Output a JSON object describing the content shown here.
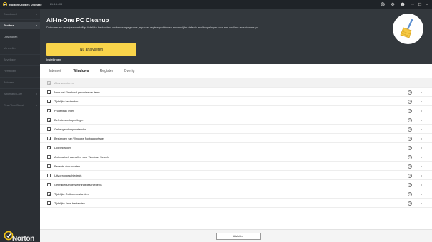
{
  "titlebar": {
    "app_title": "Norton Utilities Ultimate",
    "version": "21.4.5.408",
    "icons": [
      "globe-icon",
      "gear-icon",
      "help-icon",
      "minimize-icon",
      "maximize-icon",
      "close-icon"
    ]
  },
  "sidebar": {
    "items": [
      {
        "label": "Dashboard",
        "state": "dim",
        "has_chevron": true
      },
      {
        "label": "Toolbox",
        "state": "active",
        "has_chevron": true
      },
      {
        "label": "Opschonen",
        "state": "bright",
        "has_chevron": false
      },
      {
        "label": "Versnellen",
        "state": "dim",
        "has_chevron": false
      },
      {
        "label": "Beveiligen",
        "state": "dim",
        "has_chevron": false
      },
      {
        "label": "Herstellen",
        "state": "dim",
        "has_chevron": false
      },
      {
        "label": "Beheren",
        "state": "dim",
        "has_chevron": false
      },
      {
        "label": "Automatic Care",
        "state": "dim",
        "has_chevron": true
      },
      {
        "label": "Real-Time Boost",
        "state": "dim",
        "has_chevron": true
      }
    ],
    "brand": "Norton"
  },
  "header": {
    "title": "All-in-One PC Cleanup",
    "description": "Detecteer en verwijder overtollige tijdelijke bestanden, uw browsergegevens, repareer registerproblemen en verwijder defecte snelkoppelingen voor een snellere en schonere pc.",
    "analyze_button": "Nu analyseren",
    "settings_link": "Instellingen"
  },
  "tabs": [
    {
      "label": "Internet",
      "active": false
    },
    {
      "label": "Windows",
      "active": true
    },
    {
      "label": "Register",
      "active": false
    },
    {
      "label": "Overig",
      "active": false
    }
  ],
  "list": {
    "select_all": {
      "label": "Alles selecteren",
      "checked": true
    },
    "items": [
      {
        "label": "Naar het Klembord gekopieerde items",
        "checked": true
      },
      {
        "label": "Tijdelijke bestanden",
        "checked": true
      },
      {
        "label": "Prullenbak legen",
        "checked": true
      },
      {
        "label": "Defecte snelkoppelingen",
        "checked": true
      },
      {
        "label": "Geheugendumpbestanden",
        "checked": true
      },
      {
        "label": "Bestanden van Windows Foutrapportage",
        "checked": true
      },
      {
        "label": "Logbestanden",
        "checked": true
      },
      {
        "label": "Automatisch aanvullen voor Windows Search",
        "checked": false
      },
      {
        "label": "Recente documenten",
        "checked": false
      },
      {
        "label": "Uitvoeropgeschiedenis",
        "checked": false
      },
      {
        "label": "Gebruikersandersteuningsgeschiedenis",
        "checked": false
      },
      {
        "label": "Tijdelijke Outlook-bestanden",
        "checked": true
      },
      {
        "label": "Tijdelijke Java-bestanden",
        "checked": true
      }
    ],
    "help_glyph": "?"
  },
  "footer": {
    "close_button": "Afsluiten"
  },
  "colors": {
    "accent_button": "#f9d44a",
    "sidebar_bg": "#2b2f34",
    "header_bg": "#33383d",
    "titlebar_bg": "#1f2328"
  }
}
